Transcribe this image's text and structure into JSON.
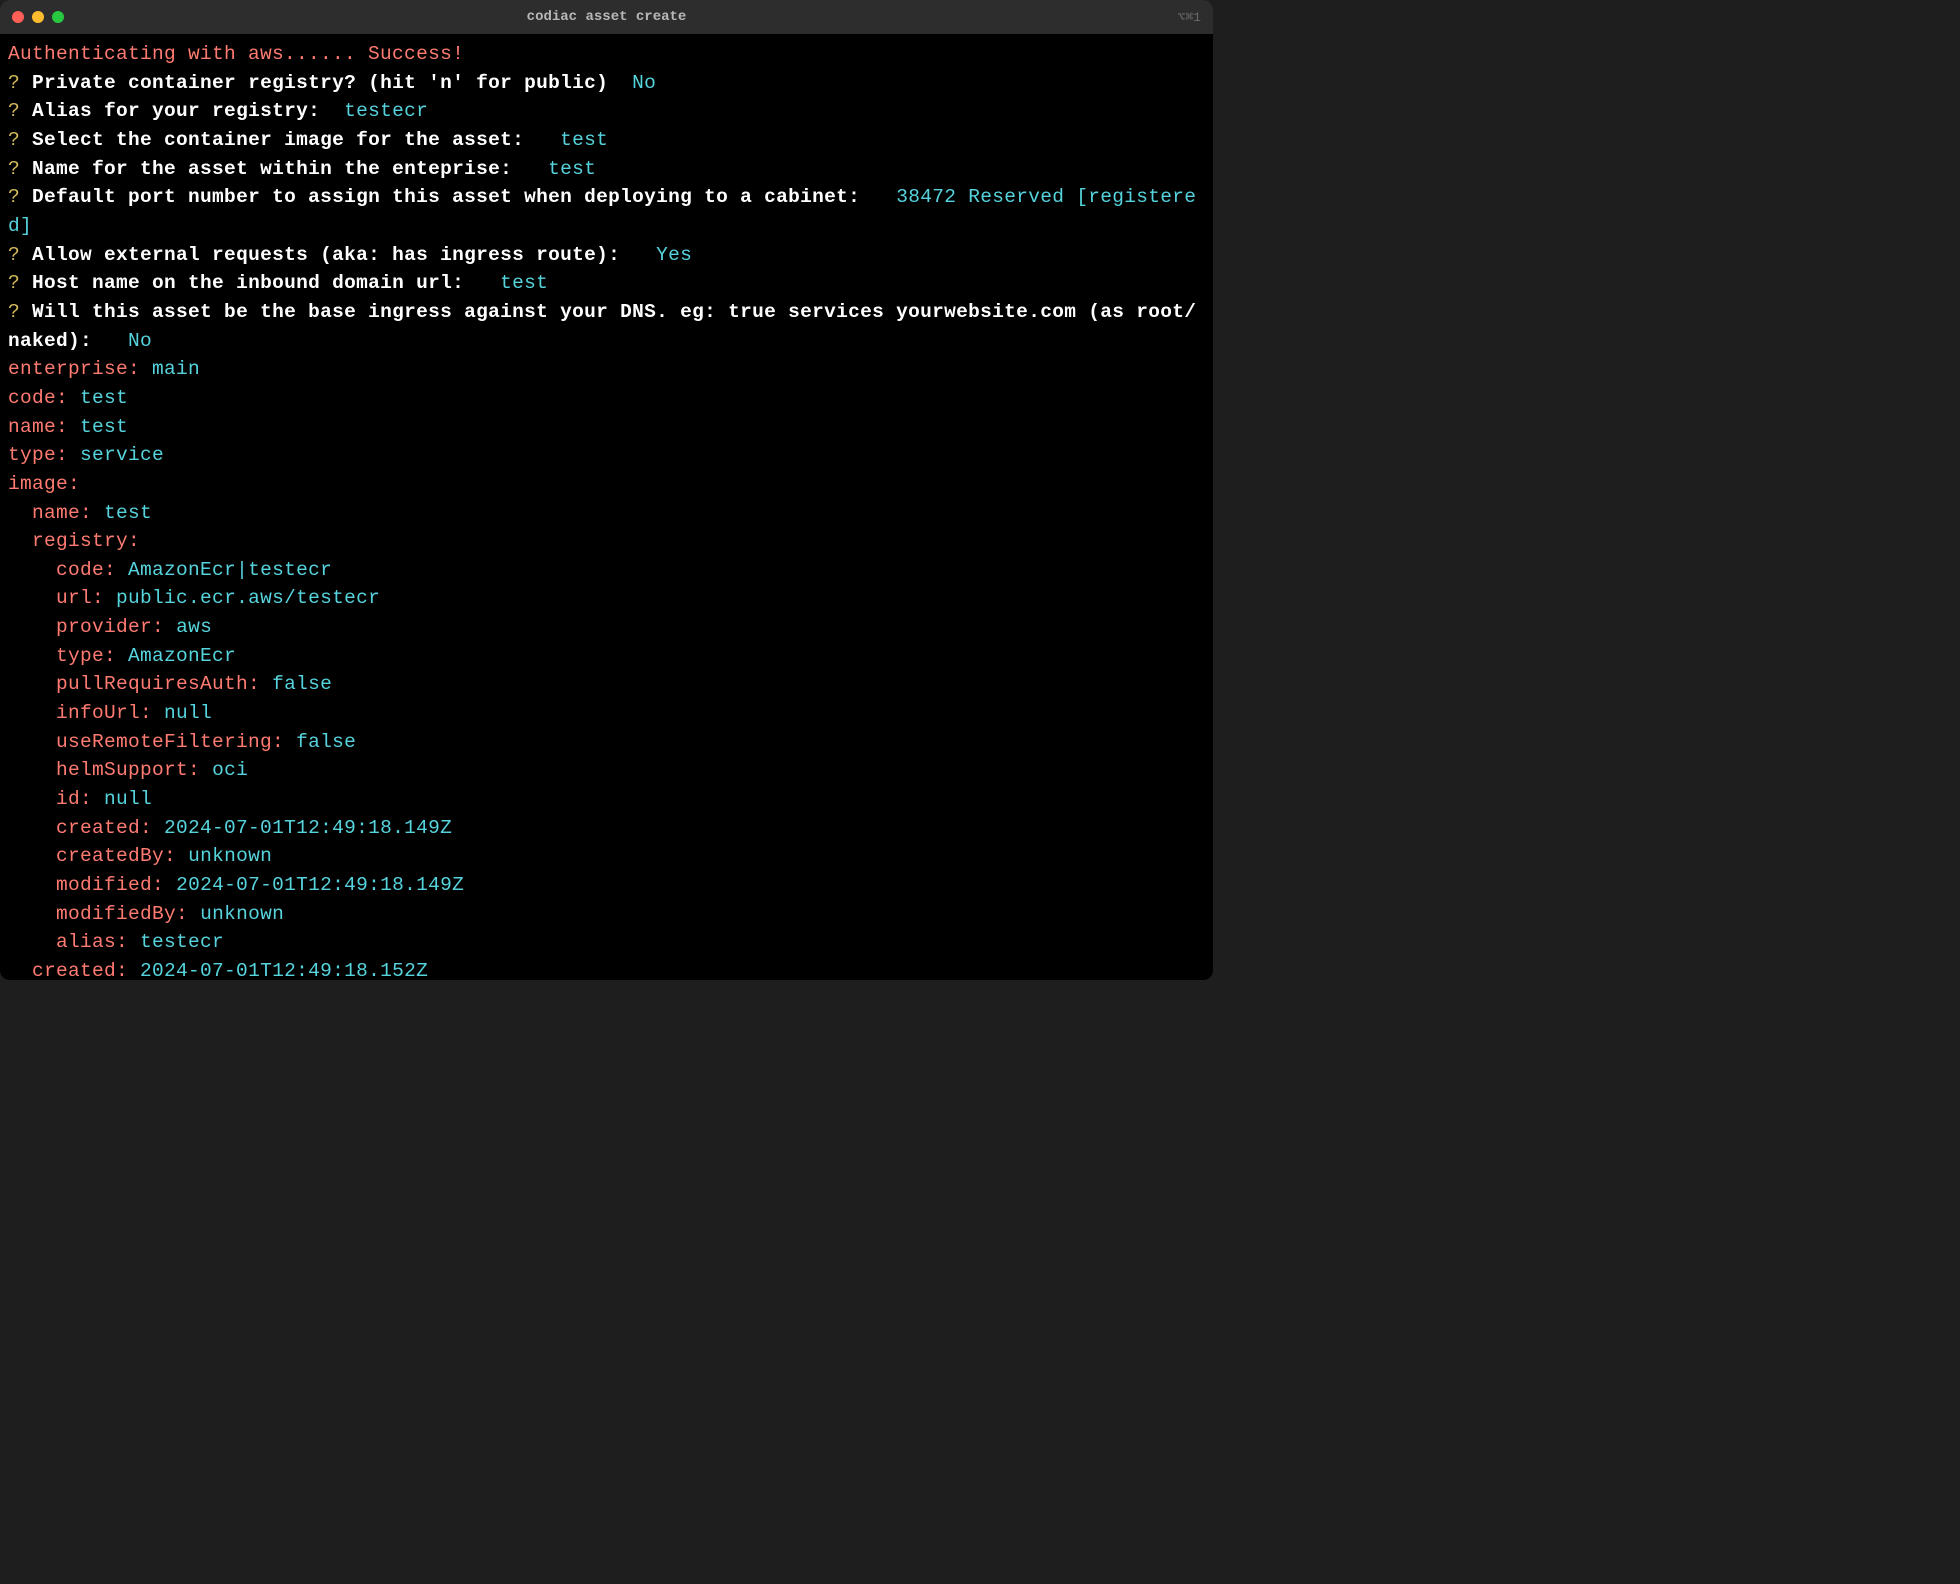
{
  "titlebar": {
    "title": "codiac asset create",
    "shortcut": "⌥⌘1"
  },
  "terminal": {
    "auth_line": "Authenticating with aws...... Success!",
    "prompts": [
      {
        "marker": "?",
        "question": "Private container registry? (hit 'n' for public)",
        "answer": "No"
      },
      {
        "marker": "?",
        "question": "Alias for your registry:",
        "answer": "testecr"
      },
      {
        "marker": "?",
        "question": "Select the container image for the asset: ",
        "answer": "test"
      },
      {
        "marker": "?",
        "question": "Name for the asset within the enteprise: ",
        "answer": "test"
      },
      {
        "marker": "?",
        "question": "Default port number to assign this asset when deploying to a cabinet: ",
        "answer": "38472 Reserved [registered]"
      },
      {
        "marker": "?",
        "question": "Allow external requests (aka: has ingress route): ",
        "answer": "Yes"
      },
      {
        "marker": "?",
        "question": "Host name on the inbound domain url: ",
        "answer": "test"
      },
      {
        "marker": "?",
        "question": "Will this asset be the base ingress against your DNS. eg: true services yourwebsite.com (as root/naked): ",
        "answer": "No"
      }
    ],
    "output": [
      {
        "key": "enterprise:",
        "value": "main",
        "indent": 0
      },
      {
        "key": "code:",
        "value": "test",
        "indent": 0
      },
      {
        "key": "name:",
        "value": "test",
        "indent": 0
      },
      {
        "key": "type:",
        "value": "service",
        "indent": 0
      },
      {
        "key": "image:",
        "value": "",
        "indent": 0
      },
      {
        "key": "name:",
        "value": "test",
        "indent": 1
      },
      {
        "key": "registry:",
        "value": "",
        "indent": 1
      },
      {
        "key": "code:",
        "value": "AmazonEcr|testecr",
        "indent": 2
      },
      {
        "key": "url:",
        "value": "public.ecr.aws/testecr",
        "indent": 2
      },
      {
        "key": "provider:",
        "value": "aws",
        "indent": 2
      },
      {
        "key": "type:",
        "value": "AmazonEcr",
        "indent": 2
      },
      {
        "key": "pullRequiresAuth:",
        "value": "false",
        "indent": 2
      },
      {
        "key": "infoUrl:",
        "value": "null",
        "indent": 2
      },
      {
        "key": "useRemoteFiltering:",
        "value": "false",
        "indent": 2
      },
      {
        "key": "helmSupport:",
        "value": "oci",
        "indent": 2
      },
      {
        "key": "id:",
        "value": "null",
        "indent": 2
      },
      {
        "key": "created:",
        "value": "2024-07-01T12:49:18.149Z",
        "indent": 2
      },
      {
        "key": "createdBy:",
        "value": "unknown",
        "indent": 2
      },
      {
        "key": "modified:",
        "value": "2024-07-01T12:49:18.149Z",
        "indent": 2
      },
      {
        "key": "modifiedBy:",
        "value": "unknown",
        "indent": 2
      },
      {
        "key": "alias:",
        "value": "testecr",
        "indent": 2
      },
      {
        "key": "created:",
        "value": "2024-07-01T12:49:18.152Z",
        "indent": 1
      }
    ]
  }
}
